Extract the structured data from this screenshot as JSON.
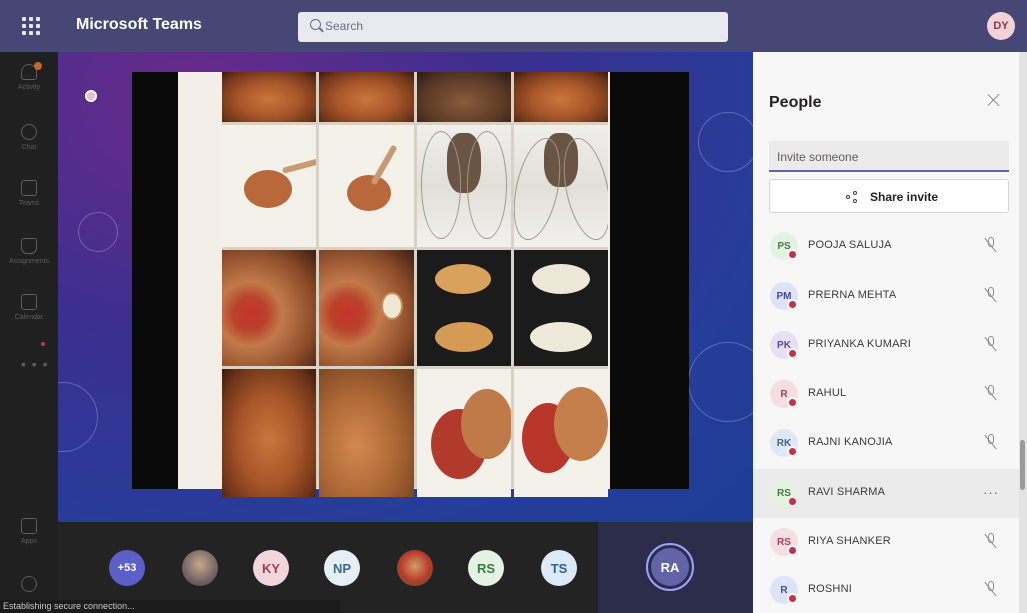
{
  "header": {
    "app_title": "Microsoft Teams",
    "search_placeholder": "Search",
    "user_initials": "DY"
  },
  "left_rail": {
    "items": [
      {
        "label": "Activity",
        "icon": "bell-icon"
      },
      {
        "label": "Chat",
        "icon": "chat-icon"
      },
      {
        "label": "Teams",
        "icon": "teams-icon"
      },
      {
        "label": "Assignments",
        "icon": "assignments-icon"
      },
      {
        "label": "Calendar",
        "icon": "calendar-icon"
      },
      {
        "label": "Apps",
        "icon": "apps-icon"
      }
    ],
    "more": "• • •"
  },
  "participants_strip": {
    "overflow_count": "+53",
    "avatars": [
      {
        "type": "photo"
      },
      {
        "initials": "KY",
        "bg": "#f3d6dc",
        "fg": "#a33a5a"
      },
      {
        "initials": "NP",
        "bg": "#e6eff5",
        "fg": "#3c6a8a"
      },
      {
        "type": "photo"
      },
      {
        "initials": "RS",
        "bg": "#e4f2e4",
        "fg": "#3c7a3c"
      },
      {
        "initials": "TS",
        "bg": "#dbe9f8",
        "fg": "#2f5e94"
      }
    ],
    "active_speaker": "RA"
  },
  "status_bar": {
    "text": "Establishing secure connection..."
  },
  "people_panel": {
    "title": "People",
    "invite_placeholder": "Invite someone",
    "share_invite_label": "Share invite",
    "people": [
      {
        "initials": "PS",
        "name": "POOJA SALUJA",
        "bg": "#e3f2e1",
        "fg": "#4a7a46",
        "action": "mic-off"
      },
      {
        "initials": "PM",
        "name": "PRERNA MEHTA",
        "bg": "#dfe3f7",
        "fg": "#454a9e",
        "action": "mic-off"
      },
      {
        "initials": "PK",
        "name": "PRIYANKA KUMARI",
        "bg": "#e6e0f4",
        "fg": "#5b4a9a",
        "action": "mic-off"
      },
      {
        "initials": "R",
        "name": "RAHUL",
        "bg": "#f6dde3",
        "fg": "#a3435c",
        "action": "mic-off"
      },
      {
        "initials": "RK",
        "name": "RAJNI KANOJIA",
        "bg": "#dfe9f4",
        "fg": "#3f6690",
        "action": "mic-off"
      },
      {
        "initials": "RS",
        "name": "RAVI SHARMA",
        "bg": "#e3f2e1",
        "fg": "#4a7a46",
        "action": "more"
      },
      {
        "initials": "RS",
        "name": "RIYA SHANKER",
        "bg": "#f6dde3",
        "fg": "#a3435c",
        "action": "mic-off"
      },
      {
        "initials": "R",
        "name": "ROSHNI",
        "bg": "#dfe3f7",
        "fg": "#454a9e",
        "action": "mic-off"
      }
    ]
  }
}
